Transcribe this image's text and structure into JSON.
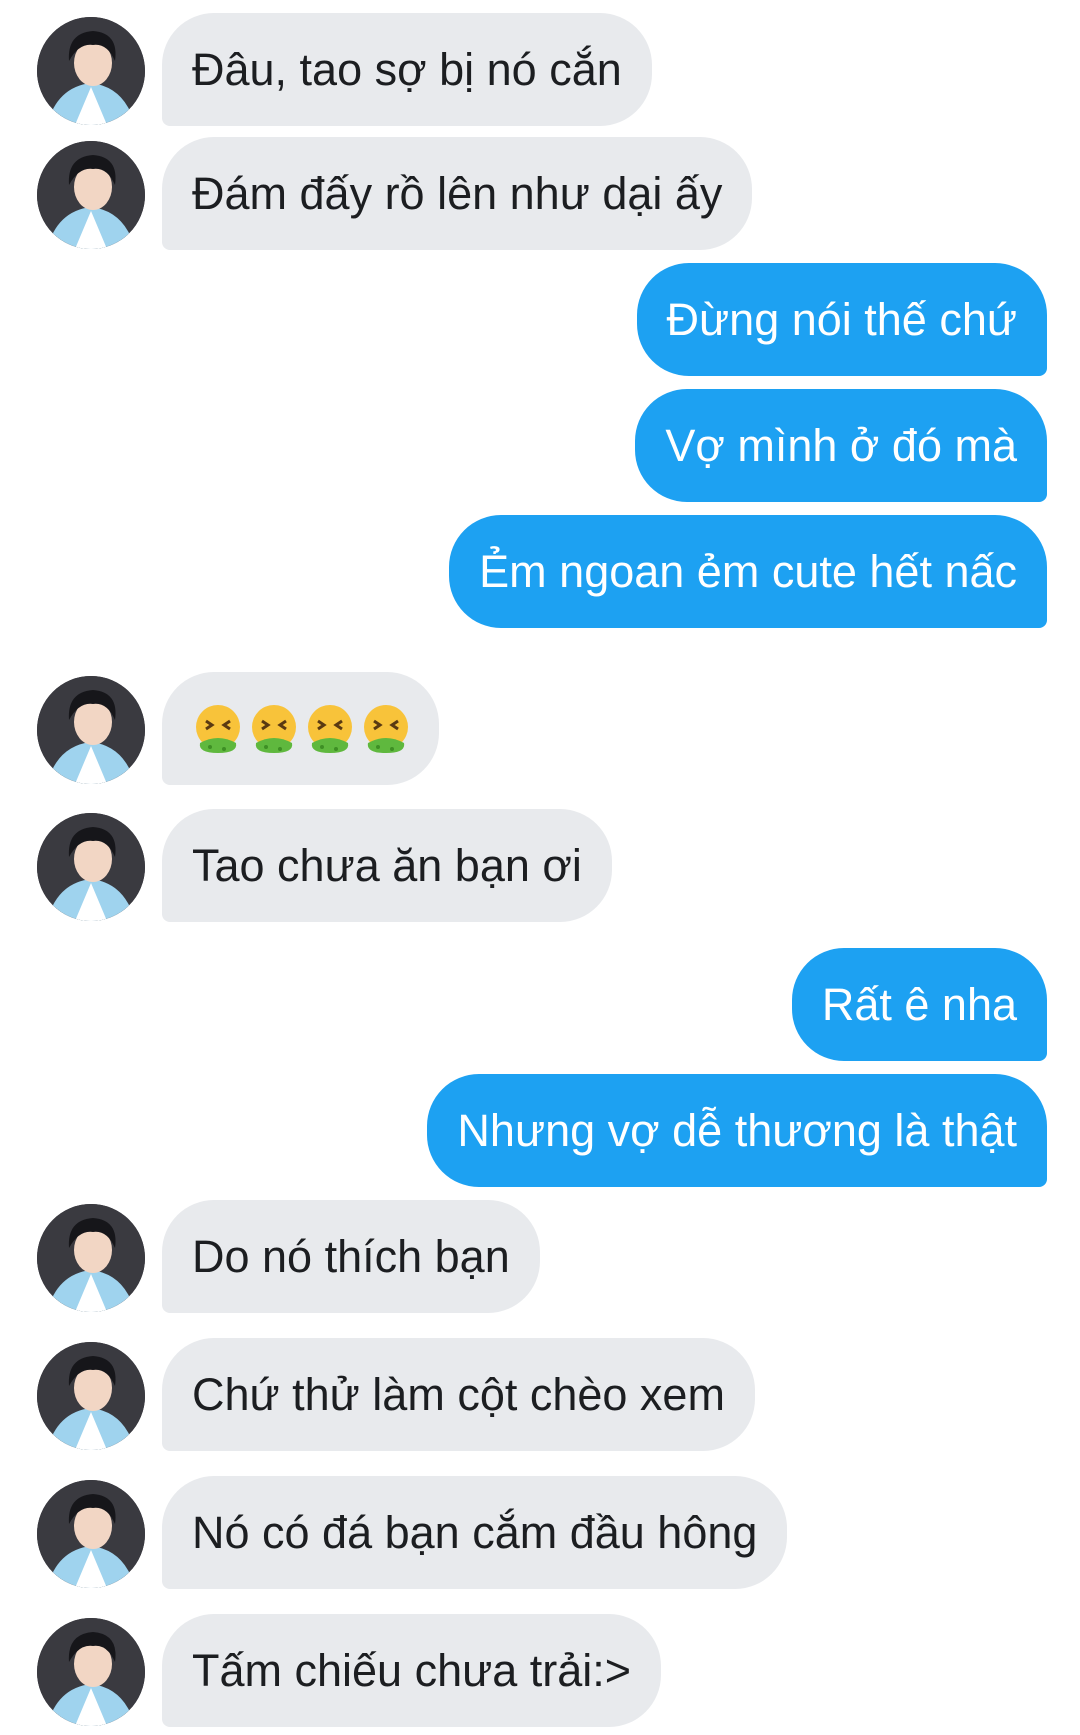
{
  "conversation": {
    "messages": [
      {
        "sender": "other",
        "text": "Đâu, tao sợ bị nó cắn"
      },
      {
        "sender": "other",
        "text": "Đám đấy rồ lên như dại ấy"
      },
      {
        "sender": "self",
        "text": "Đừng nói thế chứ"
      },
      {
        "sender": "self",
        "text": "Vợ mình ở đó mà"
      },
      {
        "sender": "self",
        "text": "Ẻm ngoan ẻm cute hết nấc"
      },
      {
        "sender": "other",
        "text": "🤮🤮🤮🤮",
        "emoji": "nauseated-face-icon",
        "emoji_count": 4
      },
      {
        "sender": "other",
        "text": "Tao chưa ăn bạn ơi"
      },
      {
        "sender": "self",
        "text": "Rất ê nha"
      },
      {
        "sender": "self",
        "text": "Nhưng vợ dễ thương là thật"
      },
      {
        "sender": "other",
        "text": "Do nó thích bạn"
      },
      {
        "sender": "other",
        "text": "Chứ thử làm cột chèo xem"
      },
      {
        "sender": "other",
        "text": "Nó có đá bạn cắm đầu hông"
      },
      {
        "sender": "other",
        "text": "Tấm chiếu chưa trải:>"
      }
    ]
  },
  "colors": {
    "incoming_bubble": "#e8eaed",
    "outgoing_bubble": "#1da1f2",
    "incoming_text": "#1c1e21",
    "outgoing_text": "#ffffff"
  }
}
